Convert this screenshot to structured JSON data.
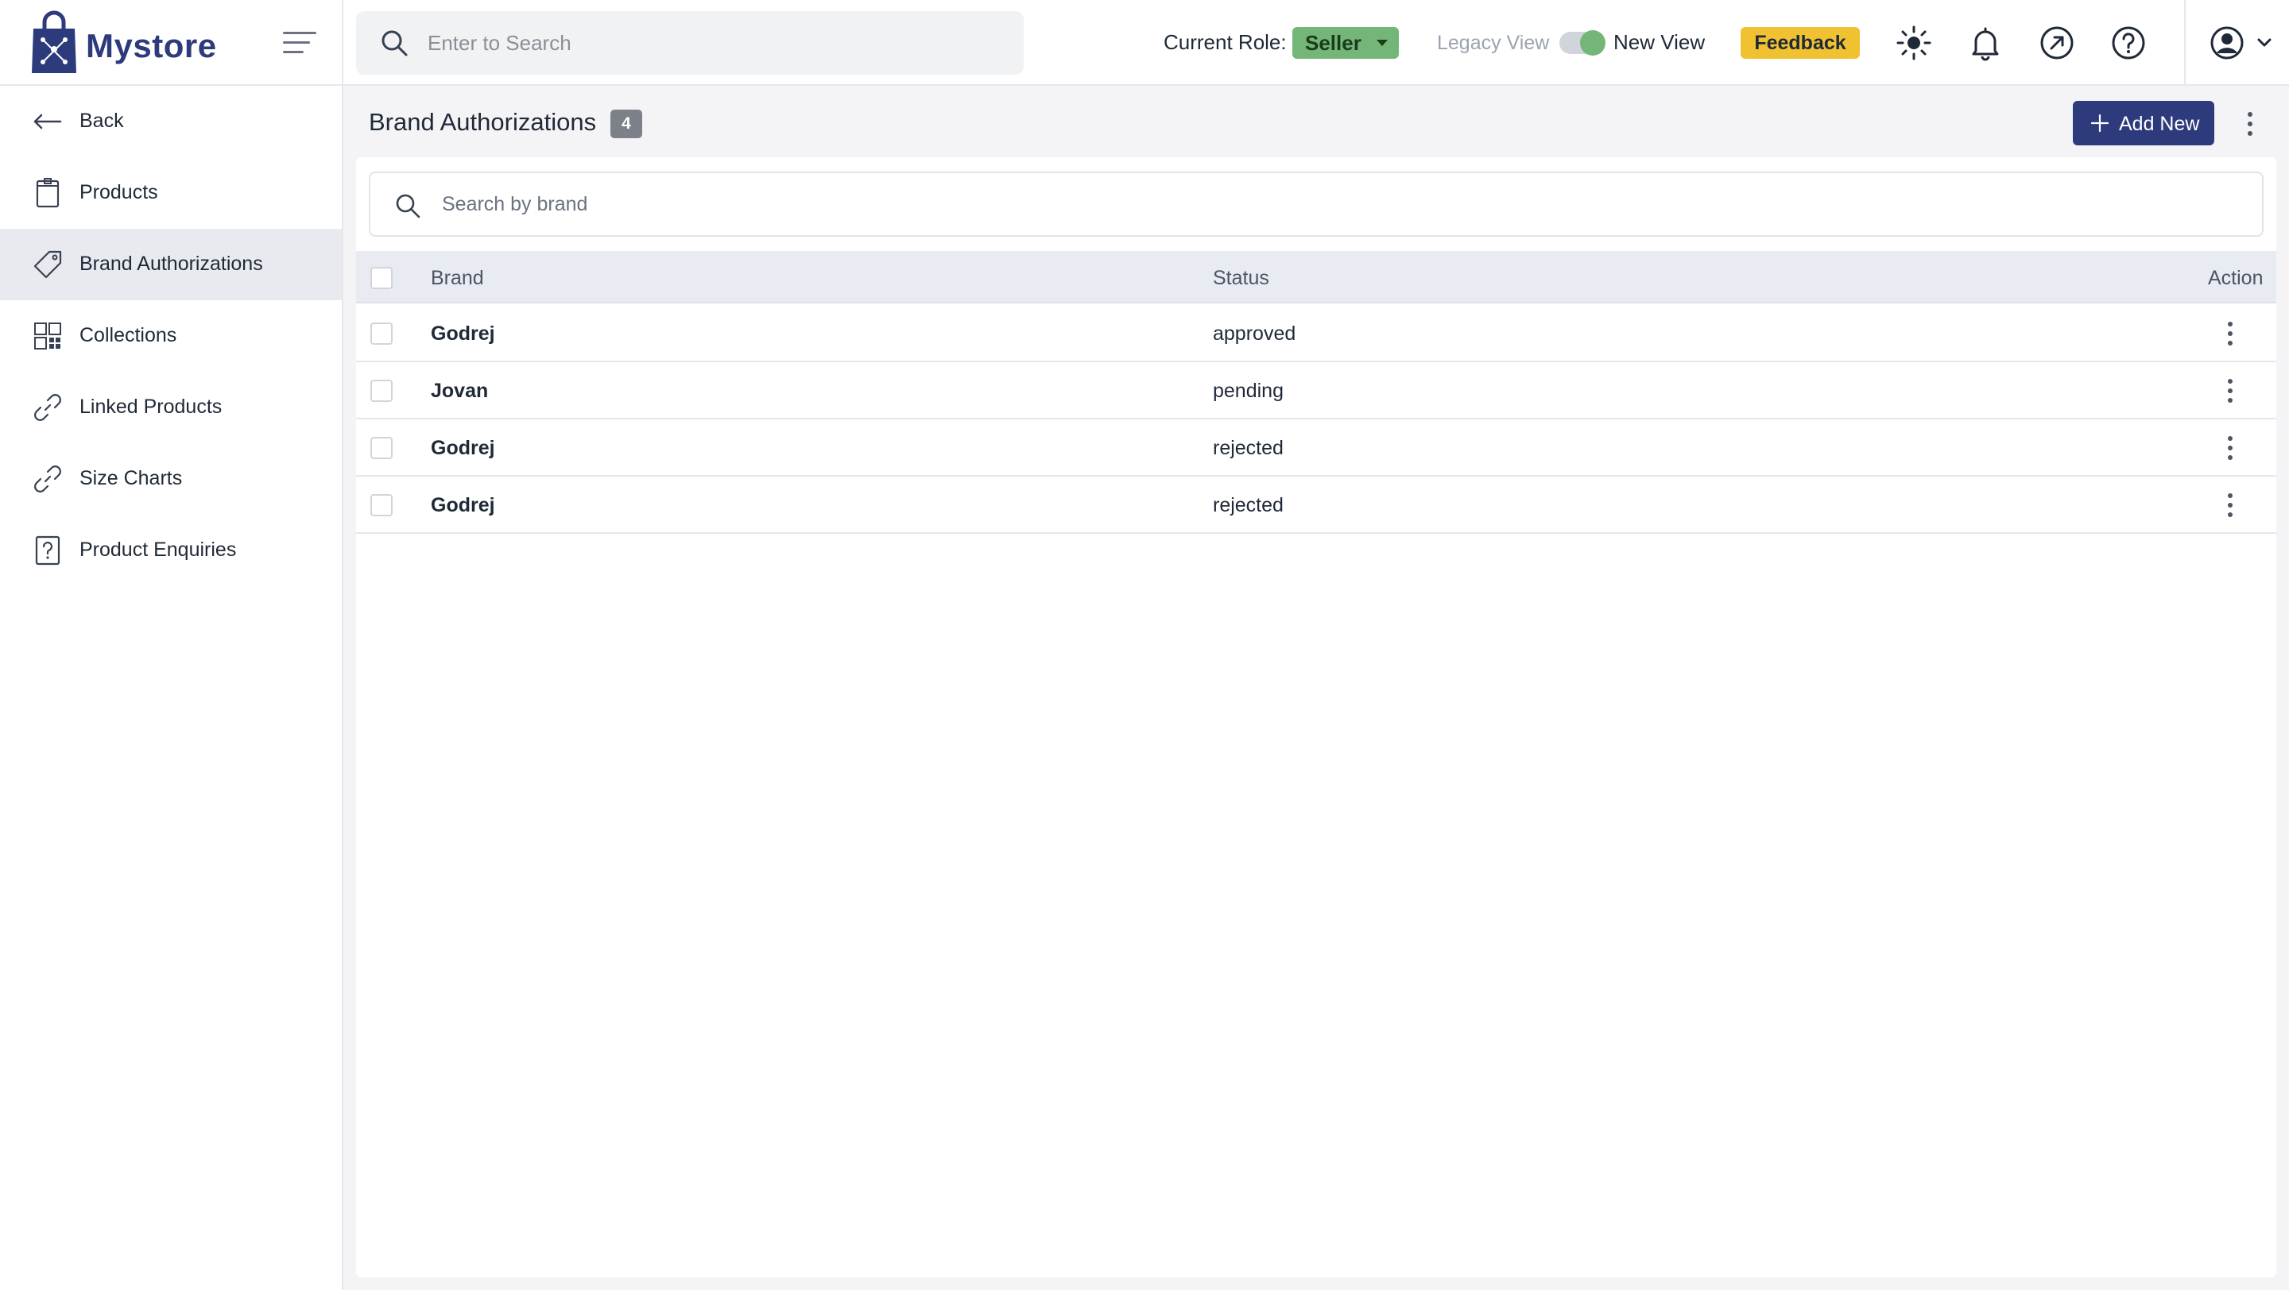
{
  "app": {
    "name": "Mystore"
  },
  "header": {
    "search_placeholder": "Enter to Search",
    "role_label": "Current Role:",
    "role_value": "Seller",
    "legacy_view_label": "Legacy View",
    "new_view_label": "New View",
    "view_toggle_on": true,
    "feedback_label": "Feedback",
    "icons": [
      "theme-sun-icon",
      "notification-bell-icon",
      "external-link-icon",
      "help-icon",
      "user-avatar-icon"
    ]
  },
  "sidebar": {
    "items": [
      {
        "label": "Back",
        "icon": "arrow-left-icon",
        "active": false
      },
      {
        "label": "Products",
        "icon": "product-box-icon",
        "active": false
      },
      {
        "label": "Brand Authorizations",
        "icon": "tag-icon",
        "active": true
      },
      {
        "label": "Collections",
        "icon": "grid-icon",
        "active": false
      },
      {
        "label": "Linked Products",
        "icon": "link-icon",
        "active": false
      },
      {
        "label": "Size Charts",
        "icon": "link-icon",
        "active": false
      },
      {
        "label": "Product Enquiries",
        "icon": "question-doc-icon",
        "active": false
      }
    ]
  },
  "main": {
    "title": "Brand Authorizations",
    "count": "4",
    "add_button_label": "Add New",
    "search_placeholder": "Search by brand",
    "table": {
      "columns": [
        "Brand",
        "Status",
        "Action"
      ],
      "rows": [
        {
          "brand": "Godrej",
          "status": "approved"
        },
        {
          "brand": "Jovan",
          "status": "pending"
        },
        {
          "brand": "Godrej",
          "status": "rejected"
        },
        {
          "brand": "Godrej",
          "status": "rejected"
        }
      ]
    }
  },
  "colors": {
    "brand_primary": "#2d3a7c",
    "role_badge": "#73b677",
    "feedback_badge": "#f0c232",
    "active_sidebar": "#e8eaef",
    "table_header": "#e9ebf2"
  }
}
